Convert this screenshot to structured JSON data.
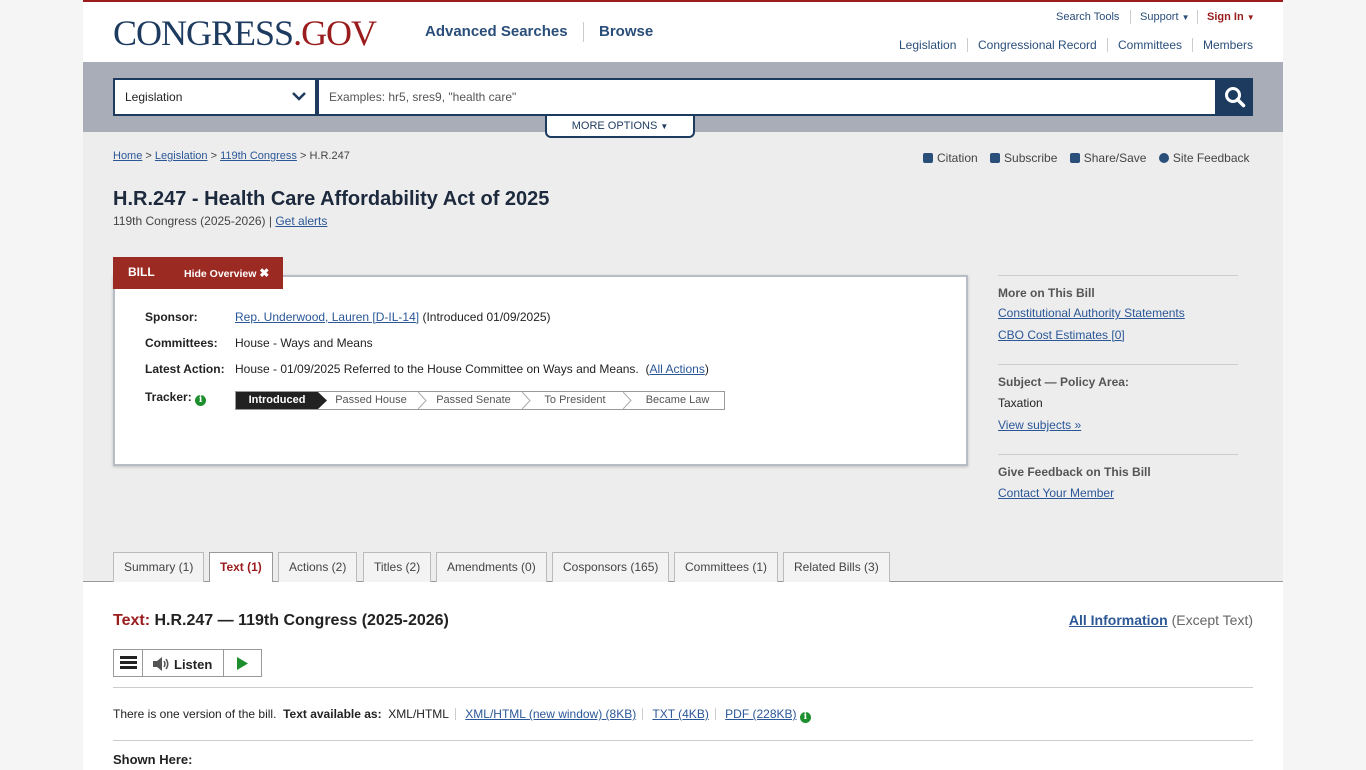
{
  "header": {
    "logo": {
      "main": "CONGRESS",
      "dot": ".",
      "gov": "GOV"
    },
    "nav": {
      "advanced": "Advanced Searches",
      "browse": "Browse"
    },
    "util": {
      "search_tools": "Search Tools",
      "support": "Support",
      "sign_in": "Sign In"
    },
    "subnav": [
      "Legislation",
      "Congressional Record",
      "Committees",
      "Members"
    ]
  },
  "search": {
    "scope": "Legislation",
    "placeholder": "Examples: hr5, sres9, \"health care\"",
    "more_options": "MORE OPTIONS"
  },
  "breadcrumb": {
    "home": "Home",
    "legislation": "Legislation",
    "congress": "119th Congress",
    "current": "H.R.247",
    "sep": ">"
  },
  "tools": {
    "citation": "Citation",
    "subscribe": "Subscribe",
    "share": "Share/Save",
    "feedback": "Site Feedback"
  },
  "bill": {
    "title": "H.R.247 - Health Care Affordability Act of 2025",
    "congress": "119th Congress (2025-2026)",
    "alerts": "Get alerts",
    "tab_label": "BILL",
    "hide_overview": "Hide Overview",
    "sponsor_label": "Sponsor:",
    "sponsor_name": "Rep. Underwood, Lauren [D-IL-14]",
    "sponsor_intro": "(Introduced 01/09/2025)",
    "committees_label": "Committees:",
    "committees_value": "House - Ways and Means",
    "latest_label": "Latest Action:",
    "latest_value": "House - 01/09/2025 Referred to the House Committee on Ways and Means.",
    "all_actions": "All Actions",
    "tracker_label": "Tracker:",
    "tracker_stages": [
      "Introduced",
      "Passed House",
      "Passed Senate",
      "To President",
      "Became Law"
    ]
  },
  "right": {
    "more_head": "More on This Bill",
    "authority": "Constitutional Authority Statements",
    "cbo": "CBO Cost Estimates [0]",
    "subject_head": "Subject — Policy Area:",
    "subject_value": "Taxation",
    "view_subjects": "View subjects",
    "feedback_head": "Give Feedback on This Bill",
    "contact": "Contact Your Member"
  },
  "tabs": [
    "Summary (1)",
    "Text (1)",
    "Actions (2)",
    "Titles (2)",
    "Amendments (0)",
    "Cosponsors (165)",
    "Committees (1)",
    "Related Bills (3)"
  ],
  "content": {
    "text_prefix": "Text:",
    "text_title": "H.R.247 — 119th Congress (2025-2026)",
    "all_info": "All Information",
    "except_text": "(Except Text)",
    "listen": "Listen",
    "one_version": "There is one version of the bill.",
    "available_as": "Text available as:",
    "formats": [
      "XML/HTML",
      "XML/HTML (new window) (8KB)",
      "TXT (4KB)",
      "PDF (228KB)"
    ],
    "shown_here": "Shown Here:"
  },
  "colors": {
    "brand_navy": "#1d3a5f",
    "brand_red": "#9a1c1c",
    "link": "#2b5797",
    "info_green": "#1e8f2e"
  }
}
